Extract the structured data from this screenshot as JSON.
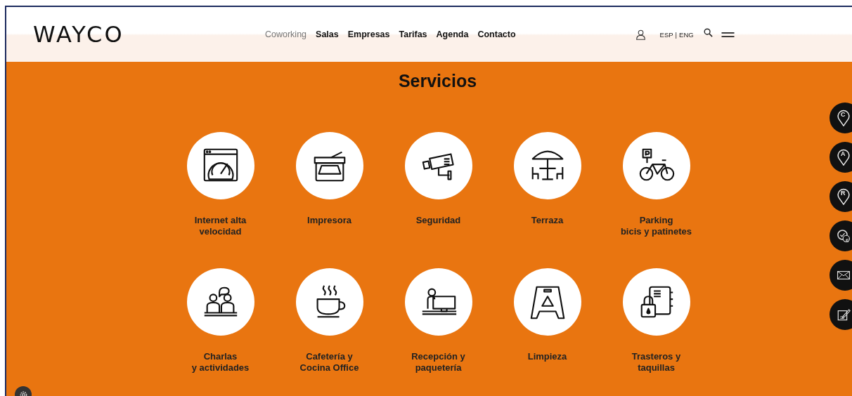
{
  "logo": "WAYCO",
  "nav": [
    {
      "label": "Coworking",
      "selected": true
    },
    {
      "label": "Salas",
      "selected": false
    },
    {
      "label": "Empresas",
      "selected": false
    },
    {
      "label": "Tarifas",
      "selected": false
    },
    {
      "label": "Agenda",
      "selected": false
    },
    {
      "label": "Contacto",
      "selected": false
    }
  ],
  "languages": [
    "ESP",
    "ENG"
  ],
  "language_separator": "|",
  "title": "Servicios",
  "services": [
    {
      "kind": "internet",
      "lines": [
        "Internet alta",
        "velocidad"
      ]
    },
    {
      "kind": "printer",
      "lines": [
        "Impresora"
      ]
    },
    {
      "kind": "camera",
      "lines": [
        "Seguridad"
      ]
    },
    {
      "kind": "terrace",
      "lines": [
        "Terraza"
      ]
    },
    {
      "kind": "parking",
      "lines": [
        "Parking",
        "bicis y patinetes"
      ]
    },
    {
      "kind": "talks",
      "lines": [
        "Charlas",
        "y actividades"
      ]
    },
    {
      "kind": "coffee",
      "lines": [
        "Cafetería y",
        "Cocina Office"
      ]
    },
    {
      "kind": "reception",
      "lines": [
        "Recepción y",
        "paquetería"
      ]
    },
    {
      "kind": "cleaning",
      "lines": [
        "Limpieza"
      ]
    },
    {
      "kind": "storage",
      "lines": [
        "Trasteros y",
        "taquillas"
      ]
    }
  ],
  "side_buttons": [
    {
      "kind": "pin",
      "label": "C"
    },
    {
      "kind": "pin",
      "label": "A"
    },
    {
      "kind": "pin",
      "label": "R"
    },
    {
      "kind": "clock",
      "label": "€"
    },
    {
      "kind": "mail"
    },
    {
      "kind": "note"
    }
  ]
}
